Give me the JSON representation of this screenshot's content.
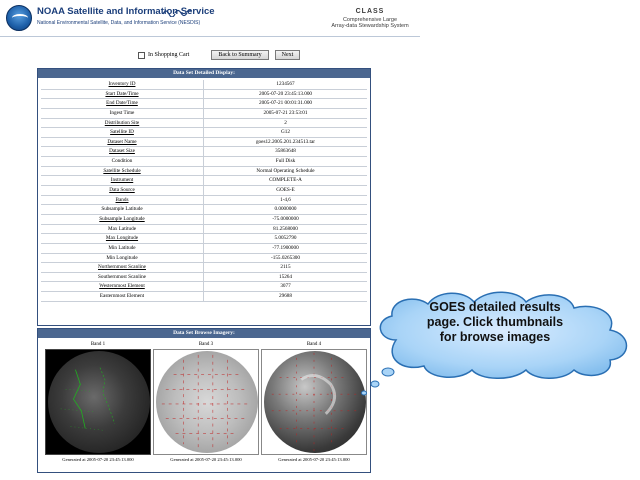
{
  "header": {
    "org_title": "NOAA Satellite and Information Service",
    "org_subtitle": "National Environmental Satellite, Data, and Information Service (NESDIS)",
    "class_mark": "CLASS",
    "class_line1": "Comprehensive Large",
    "class_line2": "Array-data Stewardship System"
  },
  "toolbar": {
    "cart_label": "In Shopping Cart",
    "summary_button": "Back to Summary",
    "next_button": "Next"
  },
  "details": {
    "title": "Data Set Detailed Display:",
    "rows": [
      {
        "key": "Inventory ID",
        "value": "1234567",
        "link": true
      },
      {
        "key": "Start Date/Time",
        "value": "2005-07-20 23:45:13.000",
        "link": true
      },
      {
        "key": "End Date/Time",
        "value": "2005-07-21 00:01:31.000",
        "link": true
      },
      {
        "key": "Ingest Time",
        "value": "2005-07-21 23:53:01",
        "link": false
      },
      {
        "key": "Distribution Site",
        "value": "2",
        "link": true
      },
      {
        "key": "Satellite ID",
        "value": "G12",
        "link": true
      },
      {
        "key": "Dataset Name",
        "value": "goes12.2005.201.234513.tar",
        "link": true
      },
      {
        "key": "Dataset Size",
        "value": "35863648",
        "link": true
      },
      {
        "key": "Condition",
        "value": "Full Disk",
        "link": false
      },
      {
        "key": "Satellite Schedule",
        "value": "Normal Operating Schedule",
        "link": true
      },
      {
        "key": "Instrument",
        "value": "COMPLETE-A",
        "link": true
      },
      {
        "key": "Data Source",
        "value": "GOES-E",
        "link": true
      },
      {
        "key": "Bands",
        "value": "1-4,6",
        "link": true
      },
      {
        "key": "Subsample Latitude",
        "value": "0.0000000",
        "link": false
      },
      {
        "key": "Subsample Longitude",
        "value": "-75.0000000",
        "link": true
      },
      {
        "key": "Max Latitude",
        "value": "81.2568000",
        "link": false
      },
      {
        "key": "Max Longitude",
        "value": "5.0052790",
        "link": true
      },
      {
        "key": "Min Latitude",
        "value": "-77.1900000",
        "link": false
      },
      {
        "key": "Min Longitude",
        "value": "-155.0265300",
        "link": false
      },
      {
        "key": "Northernmost Scanline",
        "value": "2115",
        "link": true
      },
      {
        "key": "Southernmost Scanline",
        "value": "15264",
        "link": false
      },
      {
        "key": "Westernmost Element",
        "value": "3077",
        "link": true
      },
      {
        "key": "Easternmost Element",
        "value": "29688",
        "link": false
      }
    ]
  },
  "browse": {
    "title": "Data Set Browse Imagery:",
    "thumbs": [
      {
        "band": "Band 1",
        "generated": "Generated at 2005-07-20 23:45:13.000"
      },
      {
        "band": "Band 3",
        "generated": "Generated at 2005-07-20 23:45:13.000"
      },
      {
        "band": "Band 4",
        "generated": "Generated at 2005-07-20 23:45:13.000"
      }
    ]
  },
  "callout": {
    "line1": "GOES detailed results",
    "line2": "page.  Click thumbnails",
    "line3": "for browse images"
  }
}
